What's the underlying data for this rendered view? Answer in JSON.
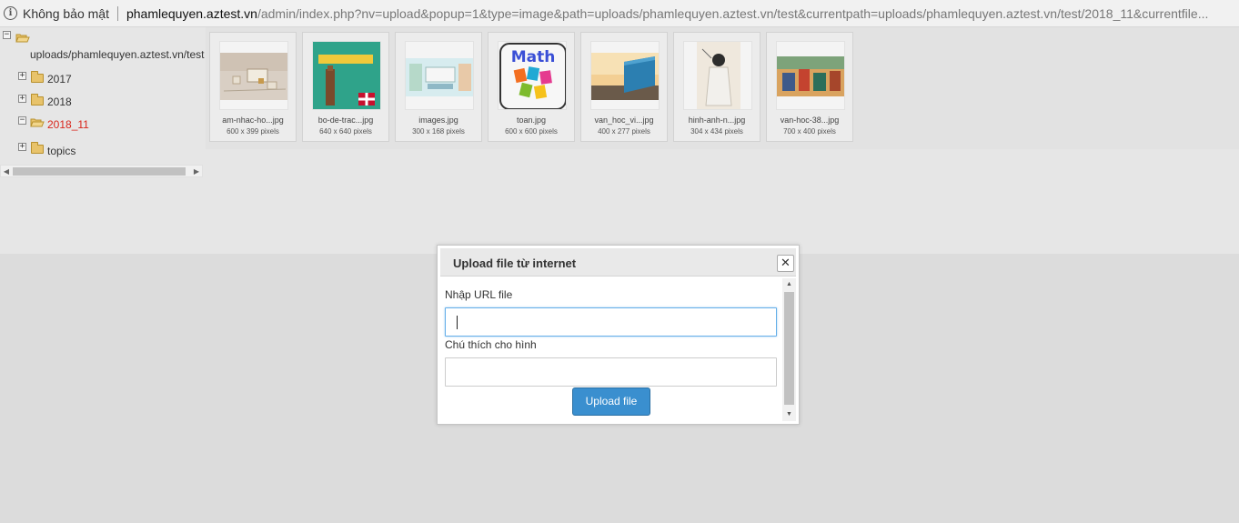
{
  "addressbar": {
    "security_text": "Không bảo mật",
    "url_host": "phamlequyen.aztest.vn",
    "url_rest": "/admin/index.php?nv=upload&popup=1&type=image&path=uploads/phamlequyen.aztest.vn/test&currentpath=uploads/phamlequyen.aztest.vn/test/2018_11&currentfile..."
  },
  "tree": {
    "root": "uploads/phamlequyen.aztest.vn/test",
    "folders": [
      {
        "label": "2017",
        "active": false
      },
      {
        "label": "2018",
        "active": false
      },
      {
        "label": "2018_11",
        "active": true
      },
      {
        "label": "topics",
        "active": false
      }
    ]
  },
  "thumbnails": [
    {
      "name": "am-nhac-ho...jpg",
      "size": "600 x 399 pixels",
      "kind": "music"
    },
    {
      "name": "bo-de-trac...jpg",
      "size": "640 x 640 pixels",
      "kind": "book"
    },
    {
      "name": "images.jpg",
      "size": "300 x 168 pixels",
      "kind": "english"
    },
    {
      "name": "toan.jpg",
      "size": "600 x 600 pixels",
      "kind": "math",
      "text": "Math"
    },
    {
      "name": "van_hoc_vi...jpg",
      "size": "400 x 277 pixels",
      "kind": "landscape"
    },
    {
      "name": "hinh-anh-n...jpg",
      "size": "304 x 434 pixels",
      "kind": "portrait"
    },
    {
      "name": "van-hoc-38...jpg",
      "size": "700 x 400 pixels",
      "kind": "painting"
    }
  ],
  "dialog": {
    "title": "Upload file từ internet",
    "close_icon": "close-icon",
    "url_label": "Nhập URL file",
    "url_value": "",
    "caption_label": "Chú thích cho hình",
    "caption_value": "",
    "upload_button": "Upload file",
    "accent_color": "#3a8fcf"
  }
}
